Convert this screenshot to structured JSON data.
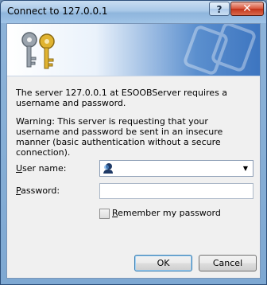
{
  "window": {
    "title": "Connect to 127.0.0.1",
    "help_label": "?",
    "close_label": "✕"
  },
  "dialog": {
    "message": "The server 127.0.0.1 at ESOOBServer requires a username and password.",
    "warning": "Warning: This server is requesting that your username and password be sent in an insecure manner (basic authentication without a secure connection).",
    "username_label_mnemonic": "U",
    "username_label_rest": "ser name:",
    "username_value": "",
    "password_label_mnemonic": "P",
    "password_label_rest": "assword:",
    "password_value": "",
    "remember_mnemonic": "R",
    "remember_rest": "emember my password",
    "remember_checked": false,
    "ok_label": "OK",
    "cancel_label": "Cancel"
  },
  "icons": {
    "banner": "keys-icon",
    "user": "user-icon",
    "dropdown": "chevron-down-icon"
  }
}
